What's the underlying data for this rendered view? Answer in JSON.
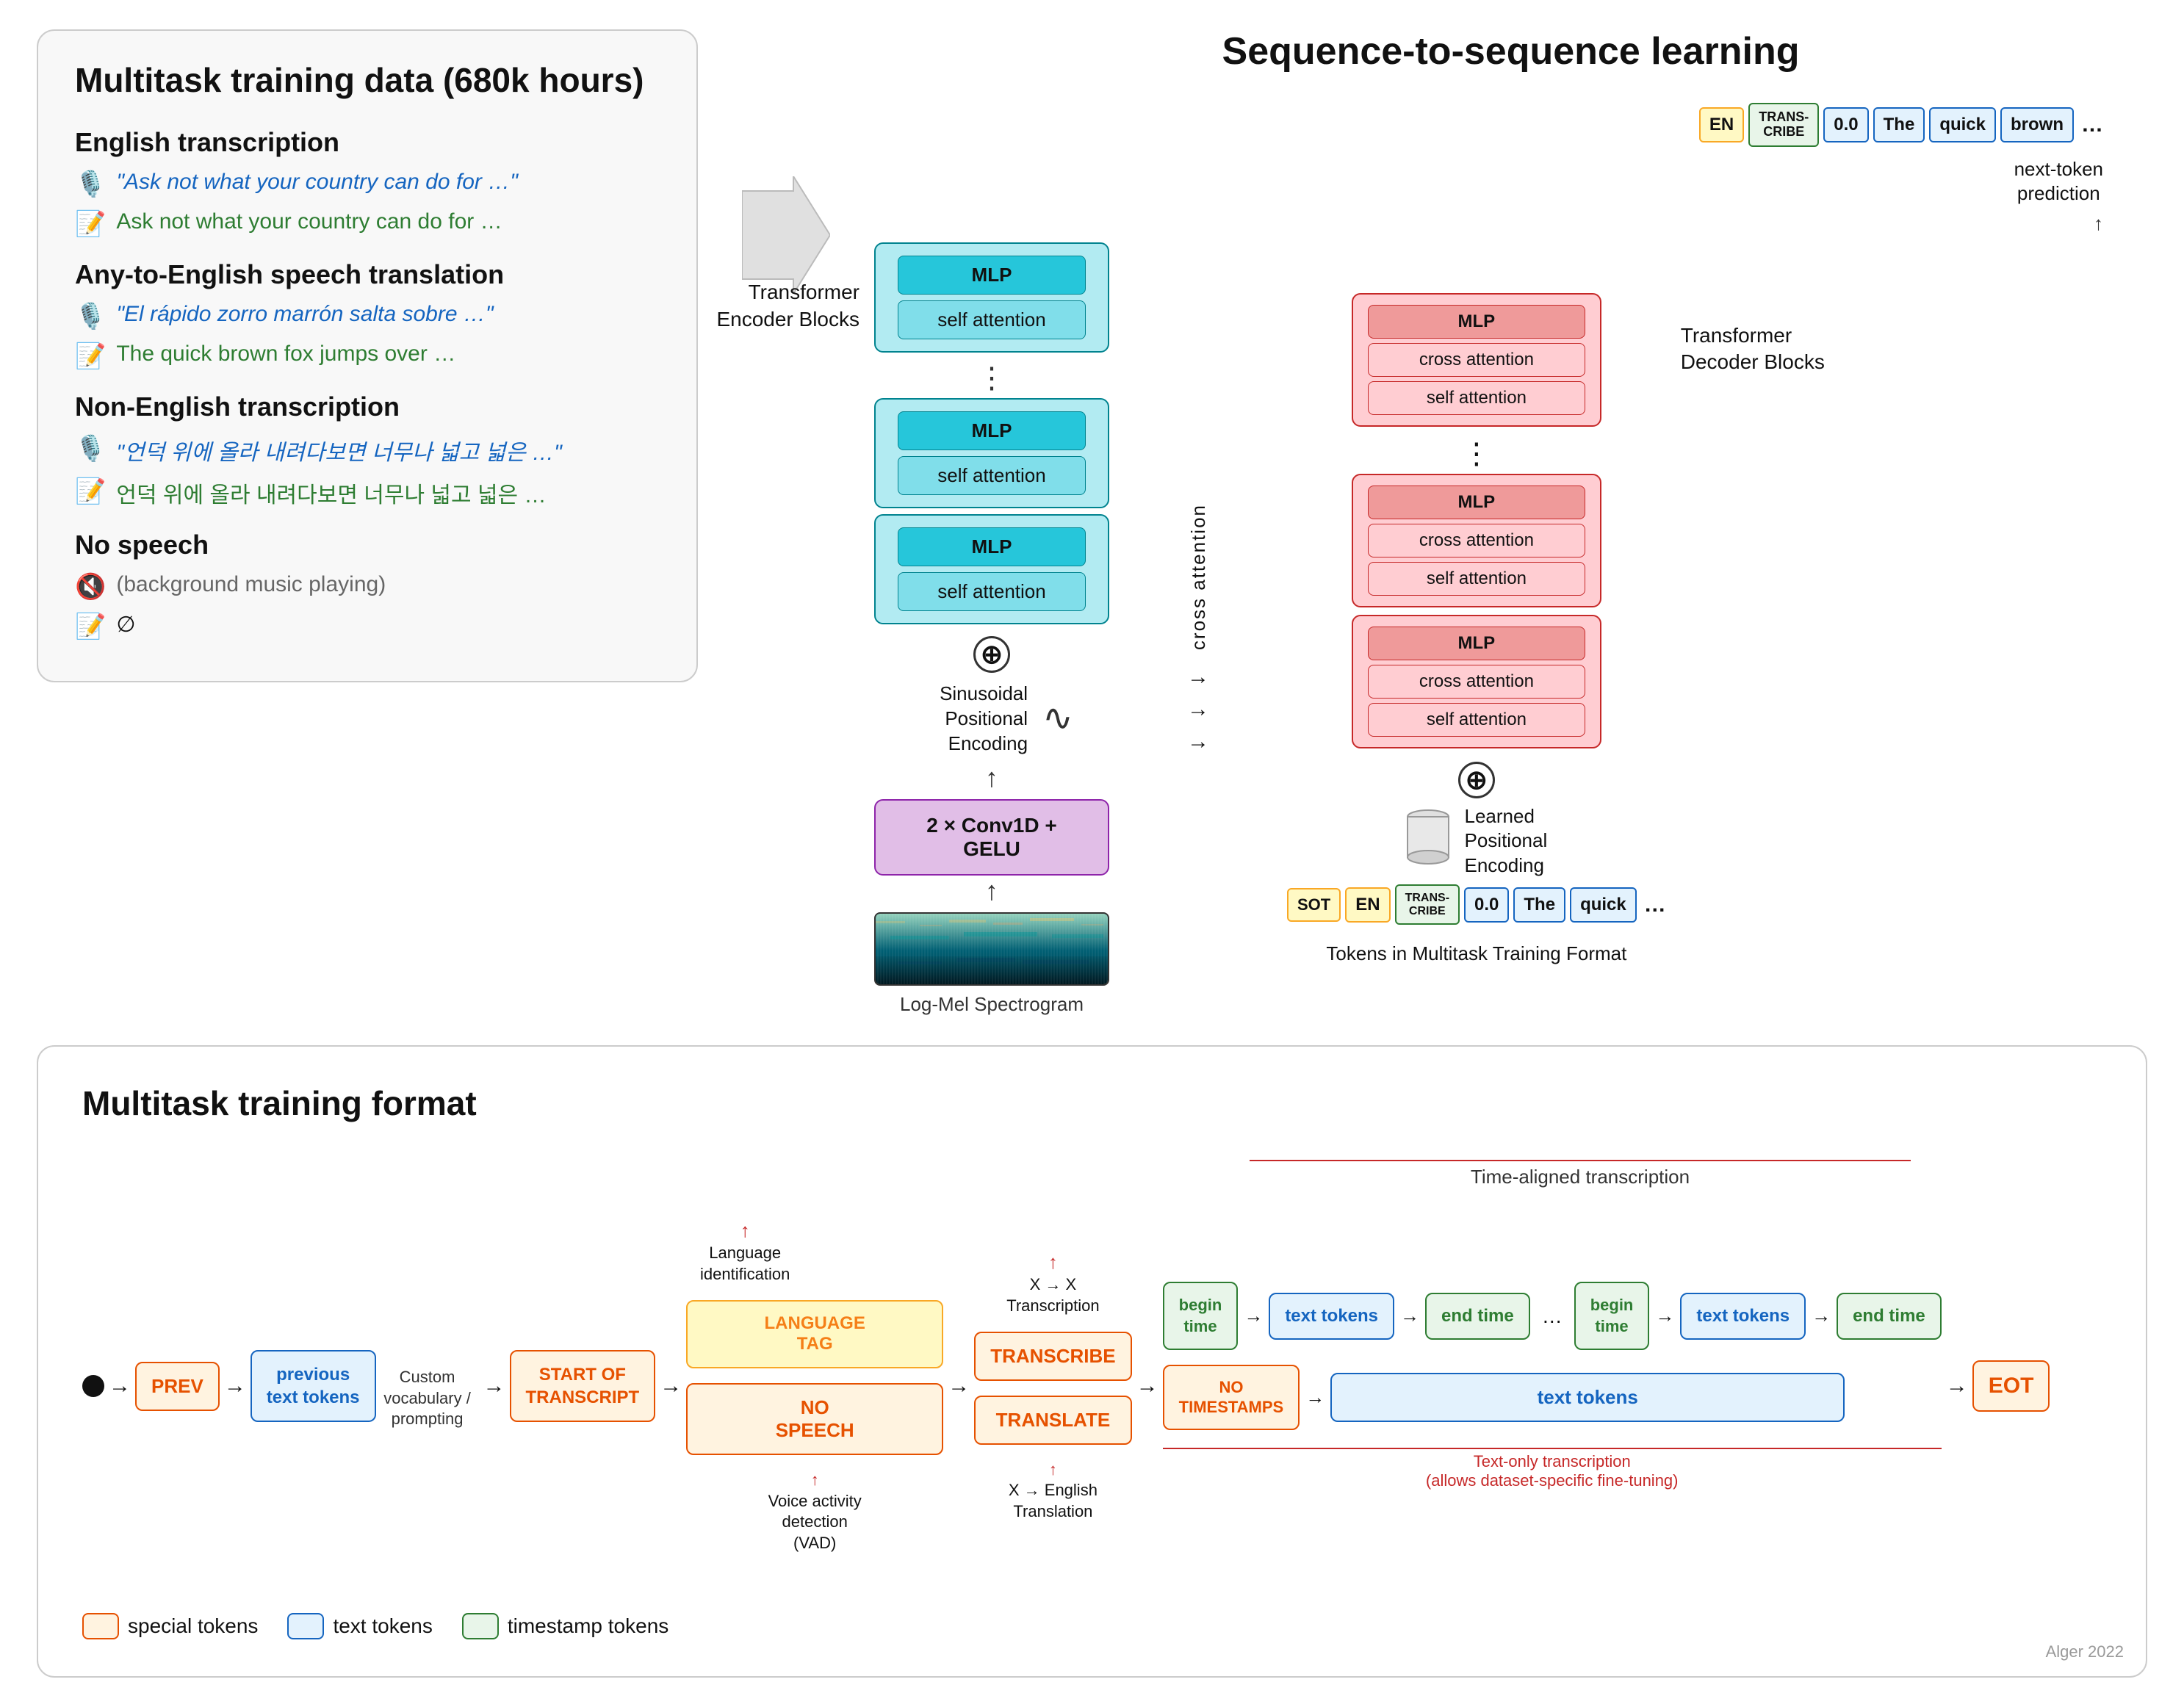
{
  "top": {
    "left_panel": {
      "title": "Multitask training data (680k hours)",
      "sections": [
        {
          "heading": "English transcription",
          "items": [
            {
              "icon": "🎙️",
              "text": "\"Ask not what your country can do for …\"",
              "style": "blue"
            },
            {
              "icon": "📝",
              "text": "Ask not what your country can do for …",
              "style": "green"
            }
          ]
        },
        {
          "heading": "Any-to-English speech translation",
          "items": [
            {
              "icon": "🎙️",
              "text": "\"El rápido zorro marrón salta sobre …\"",
              "style": "blue"
            },
            {
              "icon": "📝",
              "text": "The quick brown fox jumps over …",
              "style": "green"
            }
          ]
        },
        {
          "heading": "Non-English transcription",
          "items": [
            {
              "icon": "🎙️",
              "text": "\"언덕 위에 올라 내려다보면 너무나 넓고 넓은 …\"",
              "style": "blue"
            },
            {
              "icon": "📝",
              "text": "언덕 위에 올라 내려다보면 너무나 넓고 넓은 …",
              "style": "green"
            }
          ]
        },
        {
          "heading": "No speech",
          "items": [
            {
              "icon": "🔇",
              "text": "(background music playing)",
              "style": "gray"
            },
            {
              "icon": "📝",
              "text": "∅",
              "style": "normal"
            }
          ]
        }
      ]
    },
    "seq_title": "Sequence-to-sequence learning",
    "encoder": {
      "label": "Transformer Encoder Blocks",
      "blocks": [
        {
          "mlp": "MLP",
          "sa": "self attention"
        },
        {
          "mlp": "MLP",
          "sa": "self attention"
        },
        {
          "mlp": "MLP",
          "sa": "self attention"
        }
      ],
      "conv_label": "2 × Conv1D + GELU",
      "spectrogram_label": "Log-Mel Spectrogram",
      "sinusoidal_label": "Sinusoidal\nPositional\nEncoding"
    },
    "decoder": {
      "label": "Transformer Decoder Blocks",
      "blocks": [
        {
          "mlp": "MLP",
          "ca": "cross attention",
          "sa": "self attention"
        },
        {
          "mlp": "MLP",
          "ca": "cross attention",
          "sa": "self attention"
        },
        {
          "mlp": "MLP",
          "ca": "cross attention",
          "sa": "self attention"
        }
      ],
      "learned_label": "Learned\nPositional\nEncoding"
    },
    "top_tokens": [
      "EN",
      "TRANSCRIBE",
      "0.0",
      "The",
      "quick",
      "brown",
      "…"
    ],
    "bottom_tokens": [
      "SOT",
      "EN",
      "TRANSCRIBE",
      "0.0",
      "The",
      "quick",
      "…"
    ],
    "next_pred_label": "next-token\nprediction",
    "tokens_label": "Tokens in Multitask Training Format",
    "cross_attn_label": "cross attention"
  },
  "bottom": {
    "title": "Multitask training format",
    "labels": {
      "language_id": "Language\nidentification",
      "x_to_x": "X → X\nTranscription",
      "vad": "Voice activity\ndetection\n(VAD)",
      "x_to_en": "X → English\nTranslation",
      "custom_vocab": "Custom vocabulary /\nprompting",
      "time_aligned": "Time-aligned transcription",
      "text_only": "Text-only transcription\n(allows dataset-specific fine-tuning)",
      "english_translation": "English Translation"
    },
    "flow_nodes": {
      "prev": "PREV",
      "prev_text": "previous\ntext tokens",
      "sot": "START OF\nTRANSCRIPT",
      "language_tag": "LANGUAGE\nTAG",
      "no_speech": "NO\nSPEECH",
      "transcribe": "TRANSCRIBE",
      "translate": "TRANSLATE",
      "begin_time": "begin\ntime",
      "text_tokens": "text tokens",
      "end_time": "end time",
      "no_timestamps": "NO\nTIMESTAMPS",
      "text_tokens_long": "text tokens",
      "eot": "EOT"
    },
    "legend": [
      {
        "label": "special tokens",
        "color_bg": "#fff3e0",
        "color_border": "#e65100"
      },
      {
        "label": "text tokens",
        "color_bg": "#e3f2fd",
        "color_border": "#1565c0"
      },
      {
        "label": "timestamp tokens",
        "color_bg": "#e8f5e9",
        "color_border": "#2e7d32"
      }
    ]
  },
  "watermark": "Alger 2022"
}
